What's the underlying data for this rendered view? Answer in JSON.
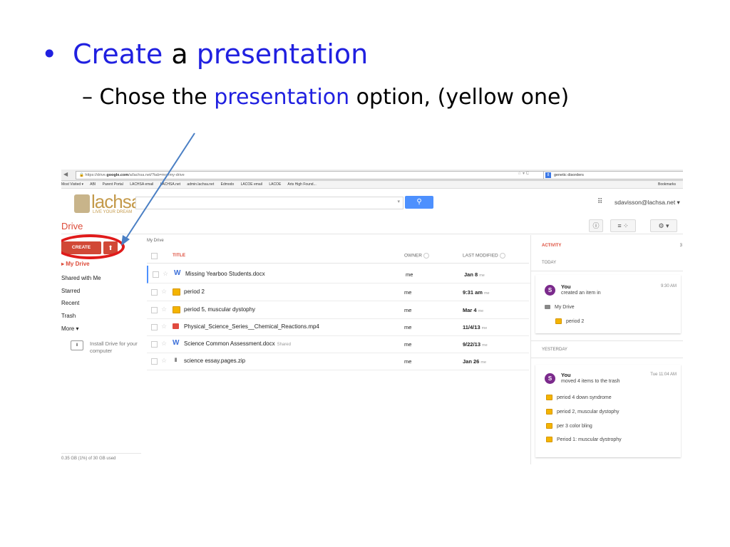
{
  "slide": {
    "bullet_glyph": "•",
    "line1_word1": "Create",
    "line1_word2": " a ",
    "line1_word3": "presentation",
    "line2_prefix": "– Chose the ",
    "line2_highlight": "presentation",
    "line2_suffix": " option, (yellow one)",
    "accent_color": "#2020e0"
  },
  "browser": {
    "url_prefix": "https://drive.",
    "url_domain": "google.com",
    "url_rest": "/a/lachsa.net/?tab=mo#my-drive",
    "search_engine_badge": "8",
    "search_query": "genetic disorders",
    "bookmarks": [
      "Most Visited ▾",
      "ABI",
      "Parent Portal",
      "LACHSA email",
      "LACHSA.net",
      "admin.lachsa.net",
      "Edmodo",
      "LACOE email",
      "LACOE",
      "Arts High Found..."
    ],
    "bookmarks_menu": "Bookmarks"
  },
  "header": {
    "logo_name": "lachsa",
    "logo_tagline": "LIVE YOUR DREAM",
    "search_button_icon": "search-icon",
    "account": "sdavisson@lachsa.net ▾",
    "drive_title": "Drive",
    "brand_red": "#dd4b39",
    "search_blue": "#4d90fe"
  },
  "sidebar": {
    "create_label": "CREATE",
    "upload_glyph": "⬆",
    "items": [
      {
        "label": "▸ My Drive",
        "active": true
      },
      {
        "label": "Shared with Me"
      },
      {
        "label": "Starred"
      },
      {
        "label": "Recent"
      },
      {
        "label": "Trash"
      },
      {
        "label": "More ▾"
      }
    ],
    "install_label": "Install Drive for your computer",
    "storage": "0.35 GB (1%) of 30 GB used"
  },
  "files": {
    "breadcrumb": "My Drive",
    "columns": {
      "title": "TITLE",
      "owner": "OWNER",
      "modified": "LAST MODIFIED"
    },
    "rows": [
      {
        "type": "doc",
        "name": "Missing Yearboo Students.docx",
        "shared": "",
        "owner": "me",
        "date": "Jan 8",
        "by": "me"
      },
      {
        "type": "slides",
        "name": "period 2",
        "shared": "",
        "owner": "me",
        "date": "9:31 am",
        "by": "me"
      },
      {
        "type": "slides",
        "name": "period 5, muscular dystophy",
        "shared": "",
        "owner": "me",
        "date": "Mar 4",
        "by": "me"
      },
      {
        "type": "video",
        "name": "Physical_Science_Series__Chemical_Reactions.mp4",
        "shared": "",
        "owner": "me",
        "date": "11/4/13",
        "by": "me"
      },
      {
        "type": "doc",
        "name": "Science Common Assessment.docx",
        "shared": "Shared",
        "owner": "me",
        "date": "9/22/13",
        "by": "me"
      },
      {
        "type": "zip",
        "name": "science essay.pages.zip",
        "shared": "",
        "owner": "me",
        "date": "Jan 26",
        "by": "me"
      }
    ]
  },
  "activity": {
    "title": "ACTIVITY",
    "close": "3",
    "today_label": "TODAY",
    "today": {
      "user": "You",
      "action": "created an item in",
      "time": "9:30 AM",
      "folder": "My Drive",
      "item": "period 2"
    },
    "yesterday_label": "YESTERDAY",
    "yesterday": {
      "user": "You",
      "action": "moved 4 items to the trash",
      "time": "Tue 11:04 AM",
      "items": [
        "period 4 down syndrome",
        "period 2, muscular dystophy",
        "per 3 color bling",
        "Period 1: muscular dystrophy"
      ]
    },
    "avatar_letter": "S",
    "avatar_color": "#7b2a8c"
  }
}
